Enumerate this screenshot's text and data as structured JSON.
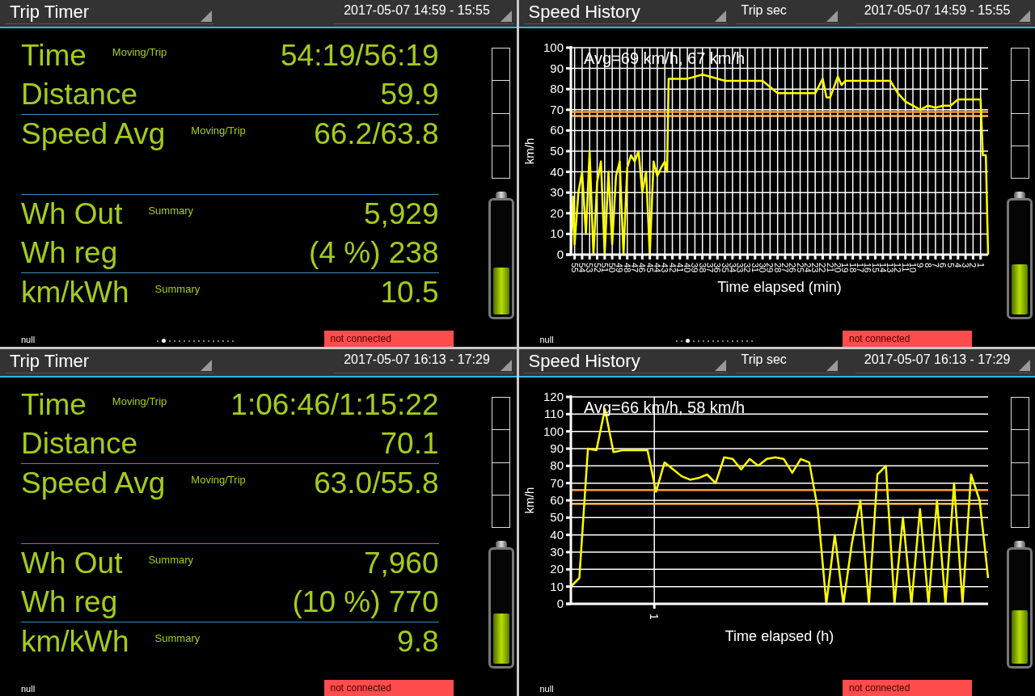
{
  "panels": [
    {
      "kind": "timer",
      "header": {
        "title": "Trip Timer",
        "date_range": "2017-05-07 14:59 - 15:55"
      },
      "sections": [
        {
          "rows": [
            {
              "label": "Time",
              "sublabel": "Moving/Trip",
              "value": "54:19/56:19",
              "divider_above": false
            },
            {
              "label": "Distance",
              "value": "59.9",
              "divider_above": false
            },
            {
              "label": "Speed Avg",
              "sublabel": "Moving/Trip",
              "value": "66.2/63.8",
              "divider_above": true
            }
          ]
        },
        {
          "rows": [
            {
              "label": "Wh Out",
              "sublabel": "Summary",
              "value": "5,929",
              "divider_above": true
            },
            {
              "label": "Wh reg",
              "value": "(4 %) 238",
              "divider_above": false
            },
            {
              "label": "km/kWh",
              "sublabel": "Summary",
              "value": "10.5",
              "divider_above": true
            }
          ]
        }
      ],
      "battery": {
        "level": 0.42
      },
      "footer": {
        "left": "null",
        "status": "not connected",
        "dots": [
          {
            "selected": false
          },
          {
            "selected": true
          },
          {
            "selected": false
          },
          {
            "selected": false
          },
          {
            "selected": false
          },
          {
            "selected": false
          },
          {
            "selected": false
          },
          {
            "selected": false
          },
          {
            "selected": false
          },
          {
            "selected": false
          },
          {
            "selected": false
          },
          {
            "selected": false
          },
          {
            "selected": false
          },
          {
            "selected": false
          },
          {
            "selected": false
          },
          {
            "selected": false
          }
        ]
      }
    },
    {
      "kind": "chart",
      "header": {
        "title": "Speed History",
        "mode": "Trip sec",
        "date_range": "2017-05-07 14:59 - 15:55"
      },
      "chart_data": {
        "type": "line",
        "xlabel": "Time elapsed (min)",
        "ylabel": "km/h",
        "xlim": [
          55.5,
          0
        ],
        "ylim": [
          0,
          100
        ],
        "xticks": [
          55,
          54,
          53,
          52,
          51,
          50,
          49,
          48,
          47,
          46,
          45,
          44,
          43,
          42,
          41,
          40,
          39,
          38,
          37,
          36,
          35,
          34,
          33,
          32,
          31,
          30,
          29,
          28,
          27,
          26,
          25,
          24,
          23,
          22,
          21,
          20,
          19,
          18,
          17,
          16,
          15,
          14,
          13,
          12,
          11,
          10,
          9,
          8,
          7,
          6,
          5,
          4,
          3,
          2,
          1
        ],
        "yticks": [
          0,
          10,
          20,
          30,
          40,
          50,
          60,
          70,
          80,
          90,
          100
        ],
        "x": [
          55.5,
          55.2,
          55,
          54.5,
          54,
          53.5,
          53,
          52.5,
          52,
          51.5,
          51,
          50.5,
          50,
          49.5,
          49,
          48.5,
          48,
          47.5,
          47,
          46.5,
          46,
          45.5,
          45,
          44.5,
          44,
          43.5,
          43,
          42.7,
          42.5,
          40,
          38,
          37,
          35,
          33,
          30,
          28,
          27,
          23,
          22,
          21.5,
          21,
          20,
          19.5,
          19,
          17,
          15,
          13,
          12,
          11,
          10,
          9,
          8,
          7,
          6,
          5,
          4,
          3,
          2,
          1,
          0.7,
          0.3,
          0
        ],
        "series": [
          {
            "color": "#ffff00",
            "values": [
              0,
              28,
              5,
              30,
              40,
              10,
              50,
              0,
              35,
              45,
              0,
              40,
              5,
              38,
              45,
              0,
              42,
              48,
              45,
              50,
              30,
              40,
              0,
              45,
              38,
              42,
              45,
              40,
              85,
              85,
              87,
              86,
              84,
              84,
              84,
              78,
              78,
              78,
              85,
              76,
              76,
              86,
              82,
              84,
              84,
              84,
              84,
              78,
              74,
              72,
              70,
              72,
              71,
              72,
              72,
              75,
              75,
              75,
              75,
              48,
              48,
              0
            ]
          },
          {
            "color": "#ff9933",
            "values": [
              69,
              69,
              69,
              69,
              69,
              69,
              69,
              69,
              69,
              69,
              69,
              69,
              69,
              69,
              69,
              69,
              69,
              69,
              69,
              69,
              69,
              69,
              69,
              69,
              69,
              69,
              69,
              69,
              69,
              69,
              69,
              69,
              69,
              69,
              69,
              69,
              69,
              69,
              69,
              69,
              69,
              69,
              69,
              69,
              69,
              69,
              69,
              69,
              69,
              69,
              69,
              69,
              69,
              69,
              69,
              69,
              69,
              69,
              69,
              69,
              69,
              69
            ]
          },
          {
            "color": "#ffbb55",
            "values": [
              67,
              67,
              67,
              67,
              67,
              67,
              67,
              67,
              67,
              67,
              67,
              67,
              67,
              67,
              67,
              67,
              67,
              67,
              67,
              67,
              67,
              67,
              67,
              67,
              67,
              67,
              67,
              67,
              67,
              67,
              67,
              67,
              67,
              67,
              67,
              67,
              67,
              67,
              67,
              67,
              67,
              67,
              67,
              67,
              67,
              67,
              67,
              67,
              67,
              67,
              67,
              67,
              67,
              67,
              67,
              67,
              67,
              67,
              67,
              67,
              67,
              67
            ]
          }
        ],
        "grid": true,
        "annotations": [
          "Avg=69 km/h, 67 km/h"
        ]
      },
      "battery": {
        "level": 0.45
      },
      "footer": {
        "left": "null",
        "status": "not connected",
        "dots": [
          {
            "selected": false
          },
          {
            "selected": false
          },
          {
            "selected": true
          },
          {
            "selected": false
          },
          {
            "selected": false
          },
          {
            "selected": false
          },
          {
            "selected": false
          },
          {
            "selected": false
          },
          {
            "selected": false
          },
          {
            "selected": false
          },
          {
            "selected": false
          },
          {
            "selected": false
          },
          {
            "selected": false
          },
          {
            "selected": false
          },
          {
            "selected": false
          },
          {
            "selected": false
          }
        ]
      }
    },
    {
      "kind": "timer",
      "header": {
        "title": "Trip Timer",
        "date_range": "2017-05-07 16:13 - 17:29"
      },
      "sections": [
        {
          "rows": [
            {
              "label": "Time",
              "sublabel": "Moving/Trip",
              "value": "1:06:46/1:15:22",
              "divider_above": false
            },
            {
              "label": "Distance",
              "value": "70.1",
              "divider_above": false
            },
            {
              "label": "Speed Avg",
              "sublabel": "Moving/Trip",
              "value": "63.0/55.8",
              "divider_above": true
            }
          ]
        },
        {
          "rows": [
            {
              "label": "Wh Out",
              "sublabel": "Summary",
              "value": "7,960",
              "divider_above": true
            },
            {
              "label": "Wh reg",
              "value": "(10 %) 770",
              "divider_above": false
            },
            {
              "label": "km/kWh",
              "sublabel": "Summary",
              "value": "9.8",
              "divider_above": true
            }
          ]
        }
      ],
      "battery": {
        "level": 0.45
      },
      "footer": {
        "left": "null",
        "status": "not connected"
      }
    },
    {
      "kind": "chart",
      "header": {
        "title": "Speed History",
        "mode": "Trip sec",
        "date_range": "2017-05-07 16:13 - 17:29"
      },
      "chart_data": {
        "type": "line",
        "xlabel": "Time elapsed (h)",
        "ylabel": "km/h",
        "ylim": [
          0,
          120
        ],
        "yticks": [
          0,
          10,
          20,
          30,
          40,
          50,
          60,
          70,
          80,
          90,
          100,
          110,
          120
        ],
        "series": [
          {
            "color": "#ffff00",
            "values": [
              10,
              15,
              90,
              89,
              113,
              88,
              89,
              89,
              89,
              89,
              65,
              82,
              78,
              74,
              72,
              73,
              75,
              70,
              85,
              84,
              78,
              84,
              80,
              84,
              85,
              84,
              76,
              84,
              82,
              55,
              0,
              40,
              0,
              35,
              60,
              0,
              75,
              80,
              0,
              50,
              0,
              55,
              0,
              60,
              0,
              70,
              0,
              75,
              60,
              15
            ]
          },
          {
            "color": "#ff9933",
            "values": [
              66,
              66,
              66,
              66,
              66,
              66,
              66,
              66,
              66,
              66,
              66,
              66,
              66,
              66,
              66,
              66,
              66,
              66,
              66,
              66,
              66,
              66,
              66,
              66,
              66,
              66,
              66,
              66,
              66,
              66,
              66,
              66,
              66,
              66,
              66,
              66,
              66,
              66,
              66,
              66,
              66,
              66,
              66,
              66,
              66,
              66,
              66,
              66,
              66,
              66
            ]
          },
          {
            "color": "#ffbb55",
            "values": [
              58,
              58,
              58,
              58,
              58,
              58,
              58,
              58,
              58,
              58,
              58,
              58,
              58,
              58,
              58,
              58,
              58,
              58,
              58,
              58,
              58,
              58,
              58,
              58,
              58,
              58,
              58,
              58,
              58,
              58,
              58,
              58,
              58,
              58,
              58,
              58,
              58,
              58,
              58,
              58,
              58,
              58,
              58,
              58,
              58,
              58,
              58,
              58,
              58,
              58
            ]
          }
        ],
        "grid": true,
        "annotations": [
          "Avg=66 km/h, 58 km/h",
          "1"
        ]
      },
      "battery": {
        "level": 0.48
      },
      "footer": {
        "left": "null",
        "status": "not connected"
      }
    }
  ]
}
